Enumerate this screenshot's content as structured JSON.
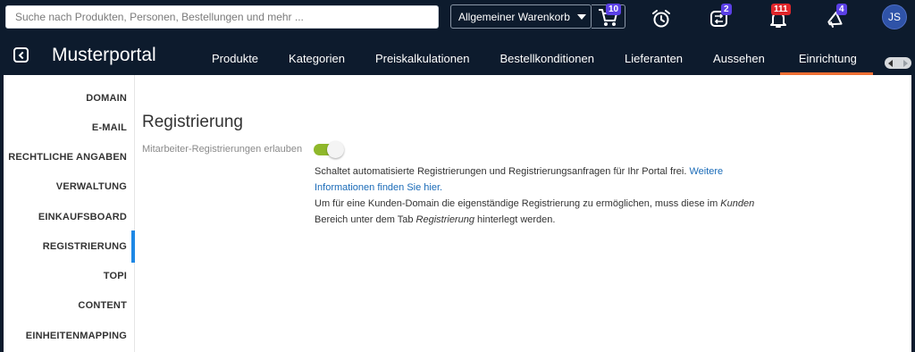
{
  "header": {
    "search_placeholder": "Suche nach Produkten, Personen, Bestellungen und mehr ...",
    "cart_selector_label": "Allgemeiner Warenkorb",
    "cart_badge": "10",
    "icons": [
      {
        "name": "alarm-clock-icon",
        "badge": ""
      },
      {
        "name": "transfer-icon",
        "badge": "2"
      },
      {
        "name": "notification-bell-icon",
        "badge": "111"
      },
      {
        "name": "megaphone-icon",
        "badge": "4"
      }
    ],
    "user_initials": "JS",
    "colors": {
      "background": "#0d1b2d",
      "badge_purple": "#5b40e6",
      "badge_red": "#e0262b",
      "avatar": "#2f53a8"
    }
  },
  "nav": {
    "portal_title": "Musterportal",
    "tabs": [
      "Produkte",
      "Kategorien",
      "Preiskalkulationen",
      "Bestellkonditionen",
      "Lieferanten",
      "Aussehen",
      "Einrichtung"
    ],
    "active_tab": "Einrichtung",
    "active_color": "#ee6e33"
  },
  "sidebar": {
    "items": [
      "DOMAIN",
      "E-MAIL",
      "RECHTLICHE ANGABEN",
      "VERWALTUNG",
      "EINKAUFSBOARD",
      "REGISTRIERUNG",
      "TOPI",
      "CONTENT",
      "EINHEITENMAPPING"
    ],
    "active_item": "REGISTRIERUNG",
    "active_color": "#1e88e5"
  },
  "main": {
    "title": "Registrierung",
    "toggle_label": "Mitarbeiter-Registrierungen erlauben",
    "toggle_on": true,
    "toggle_color": "#8fb82b",
    "desc_line1_text": "Schaltet automatisierte Registrierungen und Registrierungsanfragen für Ihr Portal frei. ",
    "desc_link_text": "Weitere Informationen finden Sie hier.",
    "desc_line2_prefix": "Um für eine Kunden-Domain die eigenständige Registrierung zu ermöglichen, muss diese im ",
    "desc_line2_em1": "Kunden",
    "desc_line2_mid": " Bereich unter dem Tab ",
    "desc_line2_em2": "Registrierung",
    "desc_line2_suffix": " hinterlegt werden."
  }
}
